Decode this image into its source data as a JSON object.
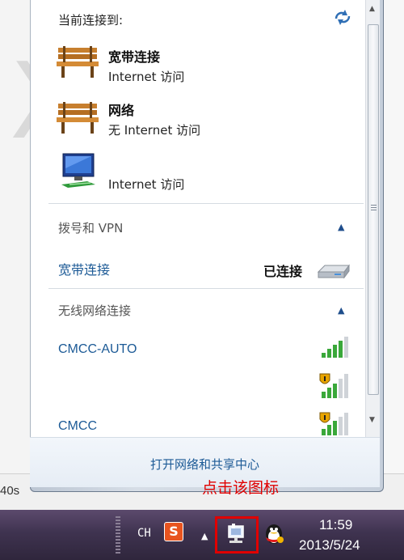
{
  "popup": {
    "header": "当前连接到:",
    "connections": [
      {
        "name": "宽带连接",
        "status": "Internet 访问"
      },
      {
        "name": "网络",
        "status": "无 Internet 访问"
      },
      {
        "name": "",
        "status": "Internet 访问"
      }
    ],
    "dialup_section": {
      "title": "拨号和 VPN",
      "item_name": "宽带连接",
      "item_status": "已连接"
    },
    "wireless_section": {
      "title": "无线网络连接",
      "networks": [
        "CMCC-AUTO",
        "",
        "CMCC"
      ]
    },
    "footer_link": "打开网络和共享中心"
  },
  "background": {
    "partial_text": "40s"
  },
  "annotation": "点击该图标",
  "taskbar": {
    "language": "CH",
    "ime_label": "S",
    "time": "11:59",
    "date": "2013/5/24"
  },
  "colors": {
    "link": "#1c5a96",
    "annotation": "#e00000",
    "taskbar": "#3f3350"
  }
}
